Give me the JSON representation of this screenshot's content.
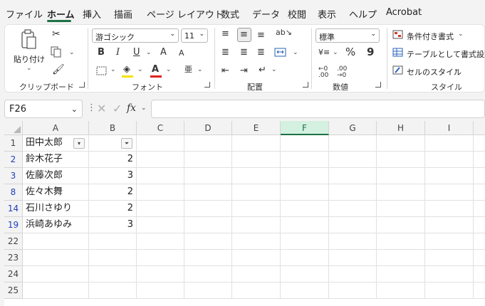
{
  "tabs": [
    "ファイル",
    "ホーム",
    "挿入",
    "描画",
    "ページ レイアウト",
    "数式",
    "データ",
    "校閲",
    "表示",
    "ヘルプ",
    "Acrobat"
  ],
  "active_tab": "ホーム",
  "ribbon": {
    "clipboard": {
      "paste_label": "貼り付け",
      "group_label": "クリップボード"
    },
    "font": {
      "font_name": "游ゴシック",
      "font_size": "11",
      "group_label": "フォント",
      "bold": "B",
      "italic": "I",
      "underline": "U",
      "grow": "A",
      "shrink": "A",
      "font_color": "A"
    },
    "alignment": {
      "group_label": "配置"
    },
    "number": {
      "format": "標準",
      "percent": "%",
      "comma": "9",
      "group_label": "数値"
    },
    "styles": {
      "conditional": "条件付き書式",
      "table": "テーブルとして書式設定",
      "cell_styles": "セルのスタイル",
      "group_label": "スタイル"
    }
  },
  "formula_bar": {
    "name_box": "F26",
    "fx": "fx",
    "formula": ""
  },
  "grid": {
    "columns": [
      "A",
      "B",
      "C",
      "D",
      "E",
      "F",
      "G",
      "H",
      "I"
    ],
    "selected_column": "F",
    "rows": [
      {
        "num": "1",
        "a": "田中太郎",
        "b": "",
        "filtered": false,
        "header": true
      },
      {
        "num": "2",
        "a": "鈴木花子",
        "b": "2",
        "filtered": true
      },
      {
        "num": "3",
        "a": "佐藤次郎",
        "b": "3",
        "filtered": true
      },
      {
        "num": "8",
        "a": "佐々木舞",
        "b": "2",
        "filtered": true
      },
      {
        "num": "14",
        "a": "石川さゆり",
        "b": "2",
        "filtered": true
      },
      {
        "num": "19",
        "a": "浜崎あゆみ",
        "b": "3",
        "filtered": true
      },
      {
        "num": "22",
        "a": "",
        "b": "",
        "filtered": false
      },
      {
        "num": "23",
        "a": "",
        "b": "",
        "filtered": false
      },
      {
        "num": "24",
        "a": "",
        "b": "",
        "filtered": false
      },
      {
        "num": "25",
        "a": "",
        "b": "",
        "filtered": false
      }
    ]
  },
  "colors": {
    "accent": "#1e7145",
    "filtered_row": "#1f3fbf",
    "selected_col_bg": "#d3f0e0"
  }
}
